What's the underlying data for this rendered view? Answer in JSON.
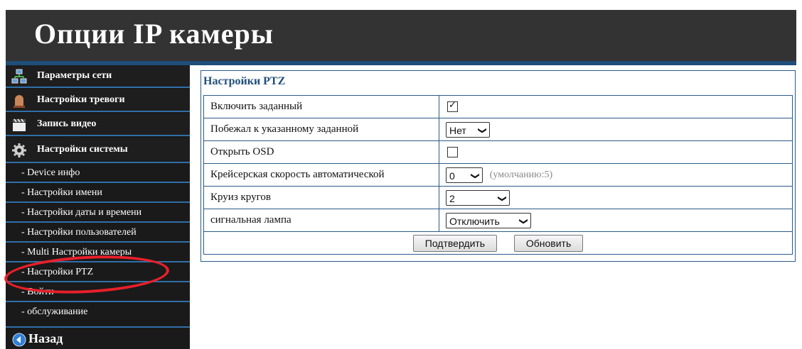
{
  "header": {
    "title": "Опции IP камеры"
  },
  "sidebar": {
    "main_items": [
      {
        "label": "Параметры сети",
        "icon": "network-icon"
      },
      {
        "label": "Настройки тревоги",
        "icon": "alarm-bell-icon"
      },
      {
        "label": "Запись видео",
        "icon": "clapperboard-icon"
      },
      {
        "label": "Настройки системы",
        "icon": "gear-icon"
      }
    ],
    "sub_items": [
      {
        "label": "- Device инфо"
      },
      {
        "label": "- Настройки имени"
      },
      {
        "label": "- Настройки даты и времени"
      },
      {
        "label": "- Настройки пользователей"
      },
      {
        "label": "- Multi Настройки камеры"
      },
      {
        "label": "- Настройки PTZ"
      },
      {
        "label": "- Войти"
      },
      {
        "label": "- обслуживание"
      }
    ],
    "back": {
      "label": "Назад",
      "icon": "back-arrow-icon"
    }
  },
  "panel": {
    "title": "Настройки PTZ",
    "rows": [
      {
        "label": "Включить заданный",
        "type": "checkbox",
        "checked": true
      },
      {
        "label": "Побежал к указанному заданной",
        "type": "select",
        "value": "Нет"
      },
      {
        "label": "Открыть OSD",
        "type": "checkbox",
        "checked": false
      },
      {
        "label": "Крейсерская скорость автоматической",
        "type": "select",
        "value": "0",
        "hint": "(умолчанию:5)"
      },
      {
        "label": "Круиз кругов",
        "type": "select",
        "value": "2"
      },
      {
        "label": "сигнальная лампа",
        "type": "select",
        "value": "Отключить"
      }
    ],
    "buttons": {
      "submit": "Подтвердить",
      "refresh": "Обновить"
    }
  },
  "colors": {
    "header_bg": "#333333",
    "accent_blue": "#1f4e79",
    "highlight_red": "#e8202a"
  }
}
